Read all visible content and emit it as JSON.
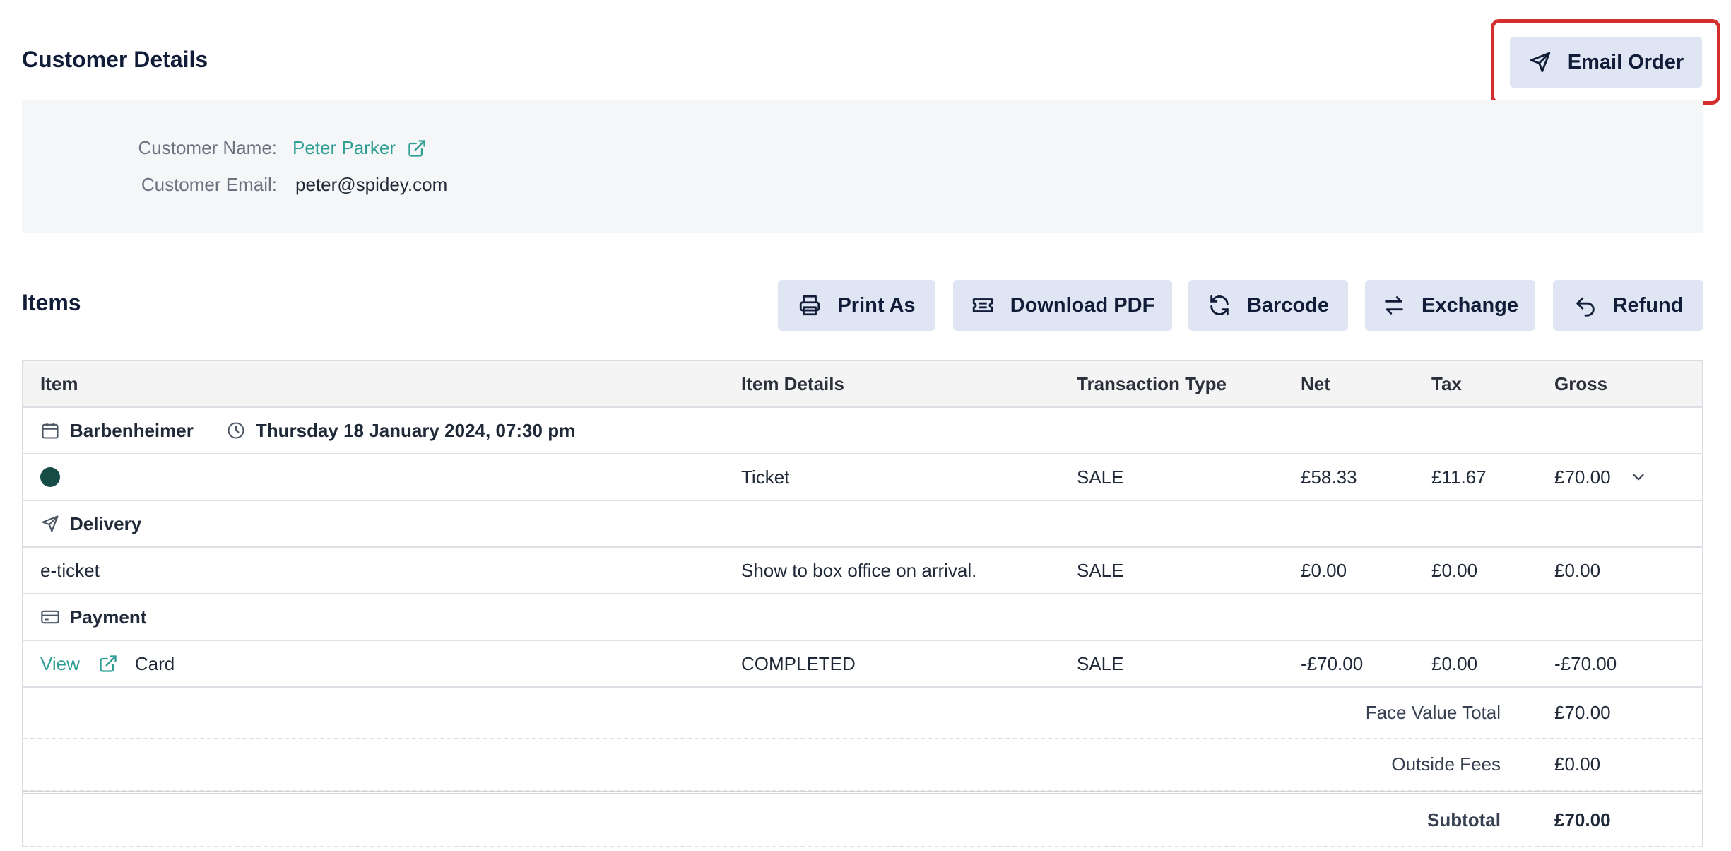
{
  "customer_details": {
    "title": "Customer Details",
    "email_order_label": "Email Order",
    "name_label": "Customer Name:",
    "name_value": "Peter Parker",
    "email_label": "Customer Email:",
    "email_value": "peter@spidey.com"
  },
  "items": {
    "title": "Items",
    "actions": {
      "print_as": "Print As",
      "download_pdf": "Download PDF",
      "barcode": "Barcode",
      "exchange": "Exchange",
      "refund": "Refund"
    },
    "columns": [
      "Item",
      "Item Details",
      "Transaction Type",
      "Net",
      "Tax",
      "Gross"
    ],
    "event_group": {
      "name": "Barbenheimer",
      "datetime": "Thursday 18 January 2024, 07:30 pm"
    },
    "ticket_row": {
      "details": "Ticket",
      "type": "SALE",
      "net": "£58.33",
      "tax": "£11.67",
      "gross": "£70.00",
      "dot_color": "#154c45"
    },
    "delivery_group": {
      "name": "Delivery"
    },
    "delivery_row": {
      "item": "e-ticket",
      "details": "Show to box office on arrival.",
      "type": "SALE",
      "net": "£0.00",
      "tax": "£0.00",
      "gross": "£0.00"
    },
    "payment_group": {
      "name": "Payment"
    },
    "payment_row": {
      "view_label": "View",
      "item": "Card",
      "details": "COMPLETED",
      "type": "SALE",
      "net": "-£70.00",
      "tax": "£0.00",
      "gross": "-£70.00"
    },
    "totals": {
      "face_value_label": "Face Value Total",
      "face_value": "£70.00",
      "outside_fees_label": "Outside Fees",
      "outside_fees": "£0.00",
      "subtotal_label": "Subtotal",
      "subtotal": "£70.00"
    }
  },
  "colors": {
    "accent_button": "#dfe5f3",
    "link": "#2f9e94",
    "highlight": "#d32f2f",
    "heading": "#111d38"
  }
}
